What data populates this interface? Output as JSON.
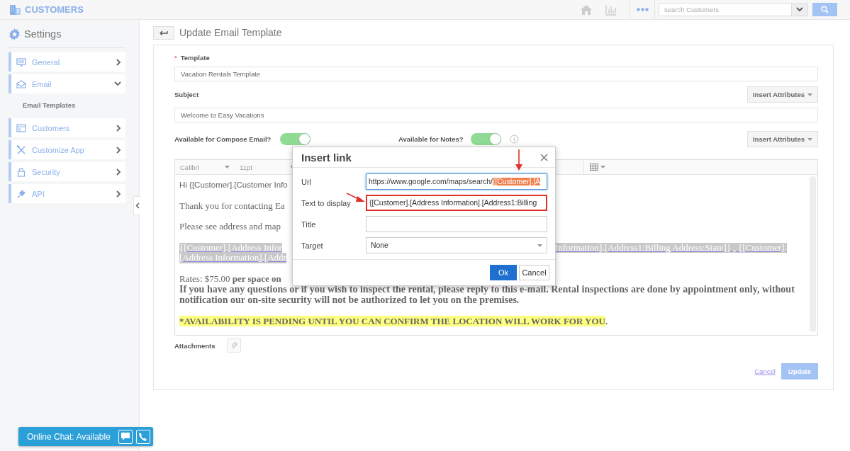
{
  "header": {
    "app_title": "CUSTOMERS",
    "search": {
      "placeholder": "search Customers"
    }
  },
  "sidebar": {
    "title": "Settings",
    "items": [
      {
        "label": "General",
        "expanded": false
      },
      {
        "label": "Email",
        "expanded": true,
        "children": [
          {
            "label": "Email Templates"
          }
        ]
      },
      {
        "label": "Customers",
        "expanded": false
      },
      {
        "label": "Customize App",
        "expanded": false
      },
      {
        "label": "Security",
        "expanded": false
      },
      {
        "label": "API",
        "expanded": false
      }
    ]
  },
  "page": {
    "title": "Update Email Template"
  },
  "form": {
    "template": {
      "label": "Template",
      "required_mark": "*",
      "value": "Vacation Rentals Template"
    },
    "subject": {
      "label": "Subject",
      "value": "Welcome to Easy Vacations",
      "insert_button": "Insert Attributes"
    },
    "toggles": [
      {
        "label": "Available for Compose Email?",
        "on": true
      },
      {
        "label": "Available for Notes?",
        "on": true
      }
    ],
    "insert_button": "Insert Attributes",
    "editor": {
      "toolbar": {
        "font": "Calibri",
        "size": "11pt"
      },
      "paragraphs": [
        {
          "lines": [
            {
              "kind": "sans",
              "left": "Hi {[Customer].[Customer Info"
            }
          ]
        },
        {
          "lines": [
            {
              "kind": "serif",
              "left": "Thank you for contacting Ea"
            }
          ]
        },
        {
          "lines": [
            {
              "kind": "serif",
              "left": "Please see address and map"
            }
          ]
        },
        {
          "lines": [
            {
              "kind": "selected",
              "left": "{[Customer].[Address Infor",
              "right": "Information].[Address1:Billing Address:State]} , {[Customer]."
            },
            {
              "kind": "selected",
              "left": "[Address Information].[Addr"
            }
          ]
        },
        {
          "lines": [
            {
              "kind": "serif",
              "left": "Rates: $75.00 **per space on**"
            },
            {
              "kind": "bold",
              "text": "If you have any questions or if you wish to inspect the rental, please reply to this e-mail. Rental inspections are done by appointment only, without notification our on-site security will not be authorized to let you on the premises."
            }
          ]
        },
        {
          "lines": [
            {
              "kind": "marked",
              "text": "*AVAILABILITY IS PENDING UNTIL YOU CAN CONFIRM THE LOCATION WILL WORK FOR YOU",
              "after": "."
            }
          ]
        }
      ]
    },
    "attachments_label": "Attachments",
    "cancel": "Cancel",
    "update": "Update"
  },
  "dialog": {
    "title": "Insert link",
    "fields": [
      {
        "label": "Url",
        "kind": "text",
        "value": "https://www.google.com/maps/search/",
        "selected_text": "{[Customer].[A",
        "focused": true,
        "annotated": false
      },
      {
        "label": "Text to display",
        "kind": "text",
        "value": "{[Customer].[Address Information].[Address1:Billing",
        "focused": false,
        "annotated": true
      },
      {
        "label": "Title",
        "kind": "text",
        "focused": false,
        "annotated": false
      },
      {
        "label": "Target",
        "kind": "select",
        "value": "None",
        "focused": false,
        "annotated": false
      }
    ],
    "ok": "Ok",
    "cancel": "Cancel"
  },
  "annotations": [
    {
      "kind": "arrow-down"
    },
    {
      "kind": "arrow-right"
    }
  ],
  "chat": {
    "label": "Online Chat: Available"
  }
}
